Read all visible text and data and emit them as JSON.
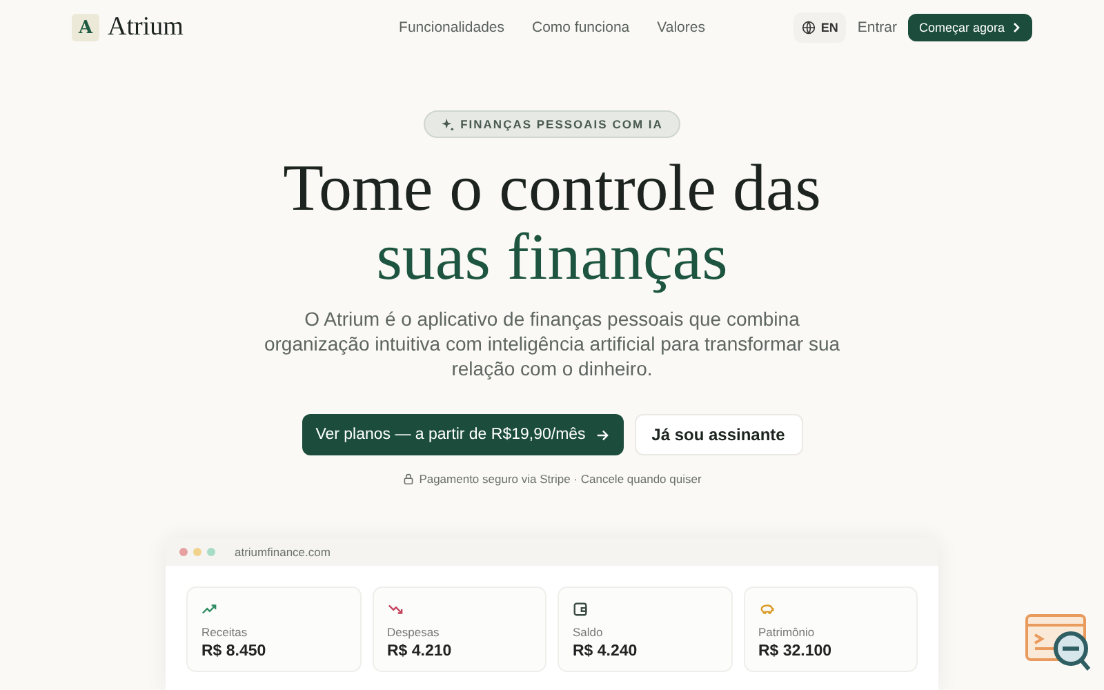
{
  "nav": {
    "logo_mark": "A",
    "brand": "Atrium",
    "links": [
      "Funcionalidades",
      "Como funciona",
      "Valores"
    ],
    "language": "EN",
    "login": "Entrar",
    "cta": "Começar agora"
  },
  "hero": {
    "badge": "FINANÇAS PESSOAIS COM IA",
    "title_line_1": "Tome o controle das",
    "title_line_2": "suas finanças",
    "description": "O Atrium é o aplicativo de finanças pessoais que combina organização intuitiva com inteligência artificial para transformar sua relação com o dinheiro.",
    "primary_button": "Ver planos — a partir de R$19,90/mês",
    "secondary_button": "Já sou assinante",
    "note": "Pagamento seguro via Stripe · Cancele quando quiser"
  },
  "preview": {
    "url": "atriumfinance.com",
    "stats": [
      {
        "kind": "trend-up",
        "color": "#2e8b62",
        "label": "Receitas",
        "value": "R$ 8.450"
      },
      {
        "kind": "trend-down",
        "color": "#c2405a",
        "label": "Despesas",
        "value": "R$ 4.210"
      },
      {
        "kind": "wallet",
        "color": "#3a4a44",
        "label": "Saldo",
        "value": "R$ 4.240"
      },
      {
        "kind": "piggy",
        "color": "#d99a22",
        "label": "Patrimônio",
        "value": "R$ 32.100"
      }
    ]
  }
}
